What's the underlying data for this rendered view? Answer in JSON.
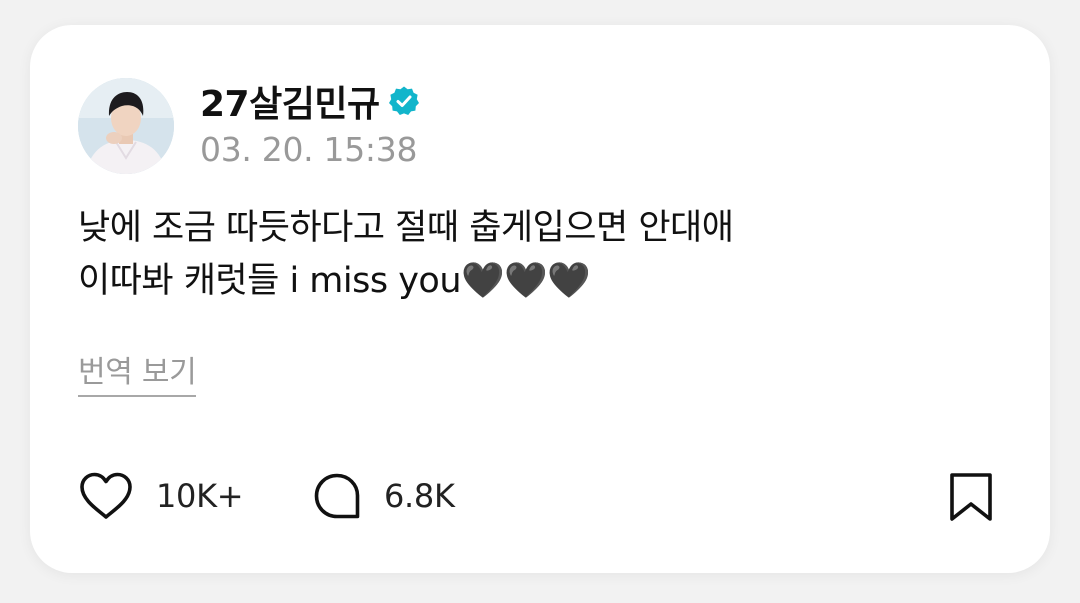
{
  "post": {
    "username": "27살김민규",
    "verified": true,
    "timestamp": "03. 20. 15:38",
    "body_line_1": "낮에 조금 따듯하다고 절때 춥게입으면 안대애",
    "body_line_2": "이따봐 캐럿들 i miss you🖤🖤🖤",
    "translate_label": "번역 보기"
  },
  "actions": {
    "like_count": "10K+",
    "reply_count": "6.8K",
    "like_icon": "heart-outline-icon",
    "reply_icon": "speech-bubble-icon",
    "bookmark_icon": "bookmark-icon"
  },
  "colors": {
    "verified_badge": "#12B5CB",
    "text_primary": "#111111",
    "text_secondary": "#999999",
    "card_background": "#FFFFFF"
  }
}
